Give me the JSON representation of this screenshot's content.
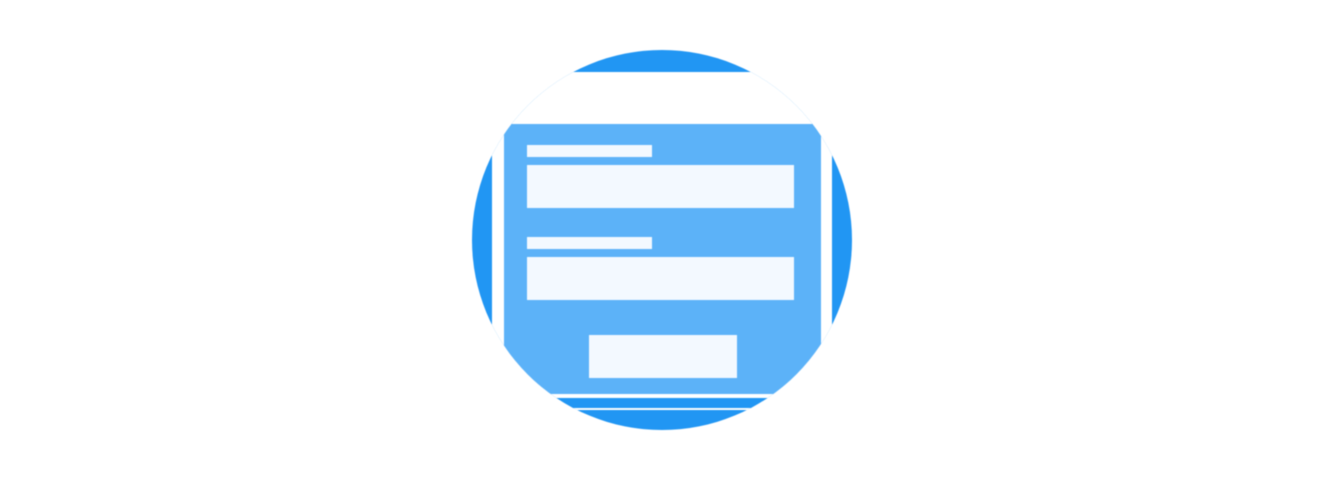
{
  "illustration": {
    "icon": "login-form-icon",
    "colors": {
      "circle": "#2196f3",
      "card": "#5cb2f8",
      "fields": "#f3f9ff",
      "background": "#ffffff"
    },
    "fields": [
      {
        "name": "field-1"
      },
      {
        "name": "field-2"
      }
    ]
  }
}
